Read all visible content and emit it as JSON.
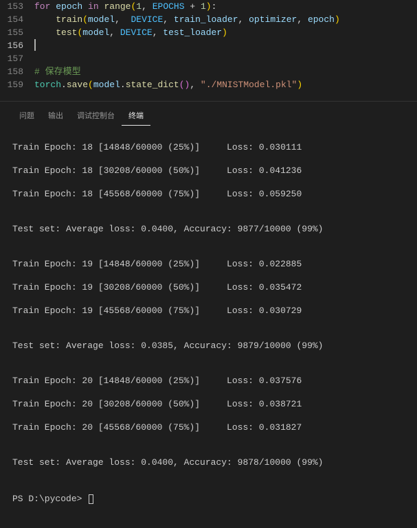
{
  "editor": {
    "lines": [
      {
        "num": "153"
      },
      {
        "num": "154"
      },
      {
        "num": "155"
      },
      {
        "num": "156"
      },
      {
        "num": "157"
      },
      {
        "num": "158"
      },
      {
        "num": "159"
      }
    ],
    "tok": {
      "for": "for",
      "epoch": "epoch",
      "in": "in",
      "range": "range",
      "one": "1",
      "comma": ", ",
      "epochs": "EPOCHS",
      "plus": " + ",
      "one2": "1",
      "colon": ":",
      "train": "train",
      "model": "model",
      "device": "DEVICE",
      "train_loader": "train_loader",
      "optimizer": "optimizer",
      "epoch_arg": "epoch",
      "test": "test",
      "test_loader": "test_loader",
      "comment_save": "# 保存模型",
      "torch": "torch",
      "dot": ".",
      "save": "save",
      "state_dict": "state_dict",
      "path_str": "\"./MNISTModel.pkl\""
    }
  },
  "tabs": {
    "problems": "问题",
    "output": "输出",
    "debug": "调试控制台",
    "terminal": "终端"
  },
  "terminal": {
    "lines": [
      "Train Epoch: 18 [14848/60000 (25%)]     Loss: 0.030111",
      "Train Epoch: 18 [30208/60000 (50%)]     Loss: 0.041236",
      "Train Epoch: 18 [45568/60000 (75%)]     Loss: 0.059250",
      "",
      "Test set: Average loss: 0.0400, Accuracy: 9877/10000 (99%)",
      "",
      "Train Epoch: 19 [14848/60000 (25%)]     Loss: 0.022885",
      "Train Epoch: 19 [30208/60000 (50%)]     Loss: 0.035472",
      "Train Epoch: 19 [45568/60000 (75%)]     Loss: 0.030729",
      "",
      "Test set: Average loss: 0.0385, Accuracy: 9879/10000 (99%)",
      "",
      "Train Epoch: 20 [14848/60000 (25%)]     Loss: 0.037576",
      "Train Epoch: 20 [30208/60000 (50%)]     Loss: 0.038721",
      "Train Epoch: 20 [45568/60000 (75%)]     Loss: 0.031827",
      "",
      "Test set: Average loss: 0.0400, Accuracy: 9878/10000 (99%)",
      ""
    ],
    "prompt": "PS D:\\pycode> "
  }
}
